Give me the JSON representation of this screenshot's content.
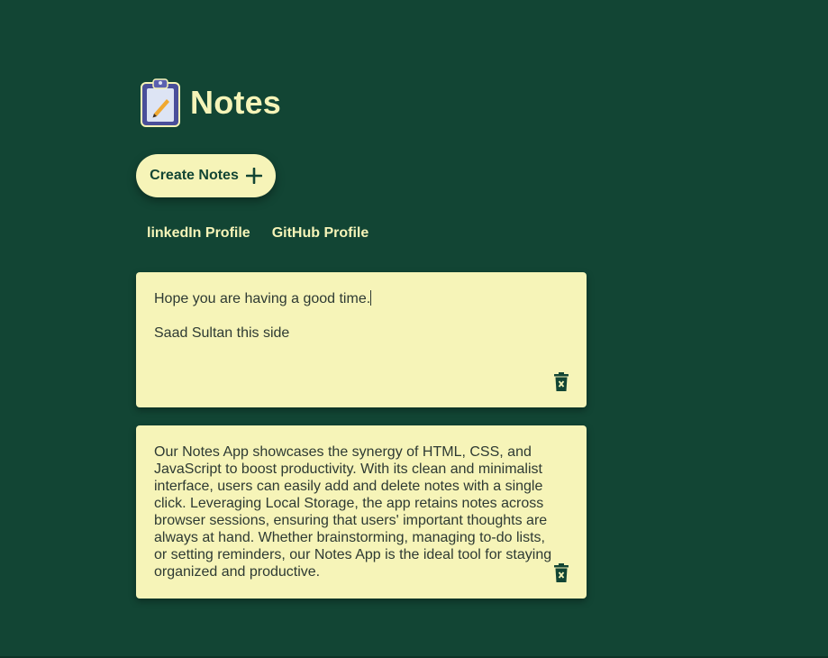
{
  "header": {
    "title": "Notes",
    "logo_icon": "clipboard-pencil-icon"
  },
  "toolbar": {
    "create_label": "Create Notes",
    "create_icon": "plus-icon"
  },
  "links": {
    "linkedin": "linkedIn Profile",
    "github": "GitHub Profile"
  },
  "notes": [
    {
      "line1": "Hope you are having a good time.",
      "line2": "Saad Sultan this side",
      "delete_icon": "trash-icon"
    },
    {
      "text": "Our Notes App showcases the synergy of HTML, CSS, and JavaScript to boost productivity. With its clean and minimalist interface, users can easily add and delete notes with a single click. Leveraging Local Storage, the app retains notes across browser sessions, ensuring that users' important thoughts are always at hand. Whether brainstorming, managing to-do lists, or setting reminders, our Notes App is the ideal tool for staying organized and productive.",
      "delete_icon": "trash-icon"
    }
  ],
  "colors": {
    "background": "#124534",
    "accent": "#f6f4b8",
    "text": "#2e3a33"
  }
}
